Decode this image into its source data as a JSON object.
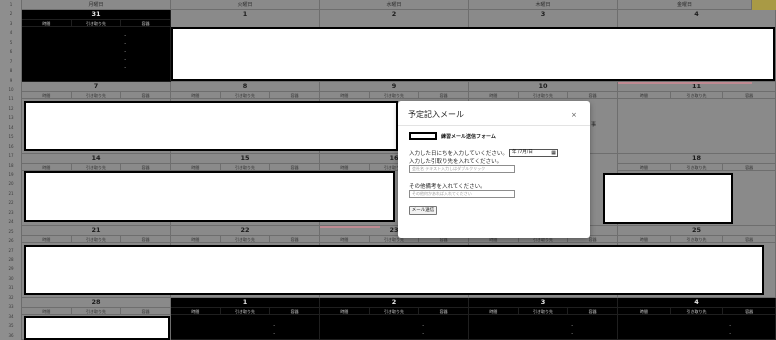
{
  "weekdays": [
    "月曜日",
    "火曜日",
    "水曜日",
    "木曜日",
    "金曜日"
  ],
  "column_labels": [
    "時間",
    "引き取り先",
    "容器"
  ],
  "dash": "-",
  "row_numbers": [
    "1",
    "2",
    "3",
    "4",
    "5",
    "6",
    "7",
    "8",
    "9",
    "10",
    "11",
    "12",
    "13",
    "14",
    "15",
    "16",
    "17",
    "18",
    "19",
    "20",
    "21",
    "22",
    "23",
    "24",
    "25",
    "26",
    "27",
    "28",
    "29",
    "30",
    "31",
    "32",
    "33",
    "34",
    "35",
    "36"
  ],
  "week1": [
    "31",
    "1",
    "2",
    "3",
    "4"
  ],
  "week2": [
    "7",
    "8",
    "9",
    "10",
    "11"
  ],
  "week3": [
    "14",
    "15",
    "16",
    "",
    "18"
  ],
  "week4": [
    "21",
    "22",
    "23",
    "",
    "25"
  ],
  "week5": [
    "28",
    "1",
    "2",
    "3",
    "4"
  ],
  "partial_text": "事",
  "modal": {
    "title": "予定記入メール",
    "close": "×",
    "mode_a": "練習メール",
    "mode_b": "送信フォーム",
    "q_date": "入力した日にちを入力していください。",
    "date_value": "年 /7月/日",
    "q_dest": "入力した引取り先を入れてください。",
    "dest_placeholder": "会社名 テキスト入力しはダブルクリック",
    "q_other": "その他備考を入れてください。",
    "other_placeholder": "その他何かあれば入れてください",
    "send": "メール送信"
  },
  "colors": {
    "sheet_gray": "#8a8a8a",
    "dark_cell": "#000000",
    "accent_gold": "#a99a45",
    "accent_pink": "#c08a92"
  }
}
